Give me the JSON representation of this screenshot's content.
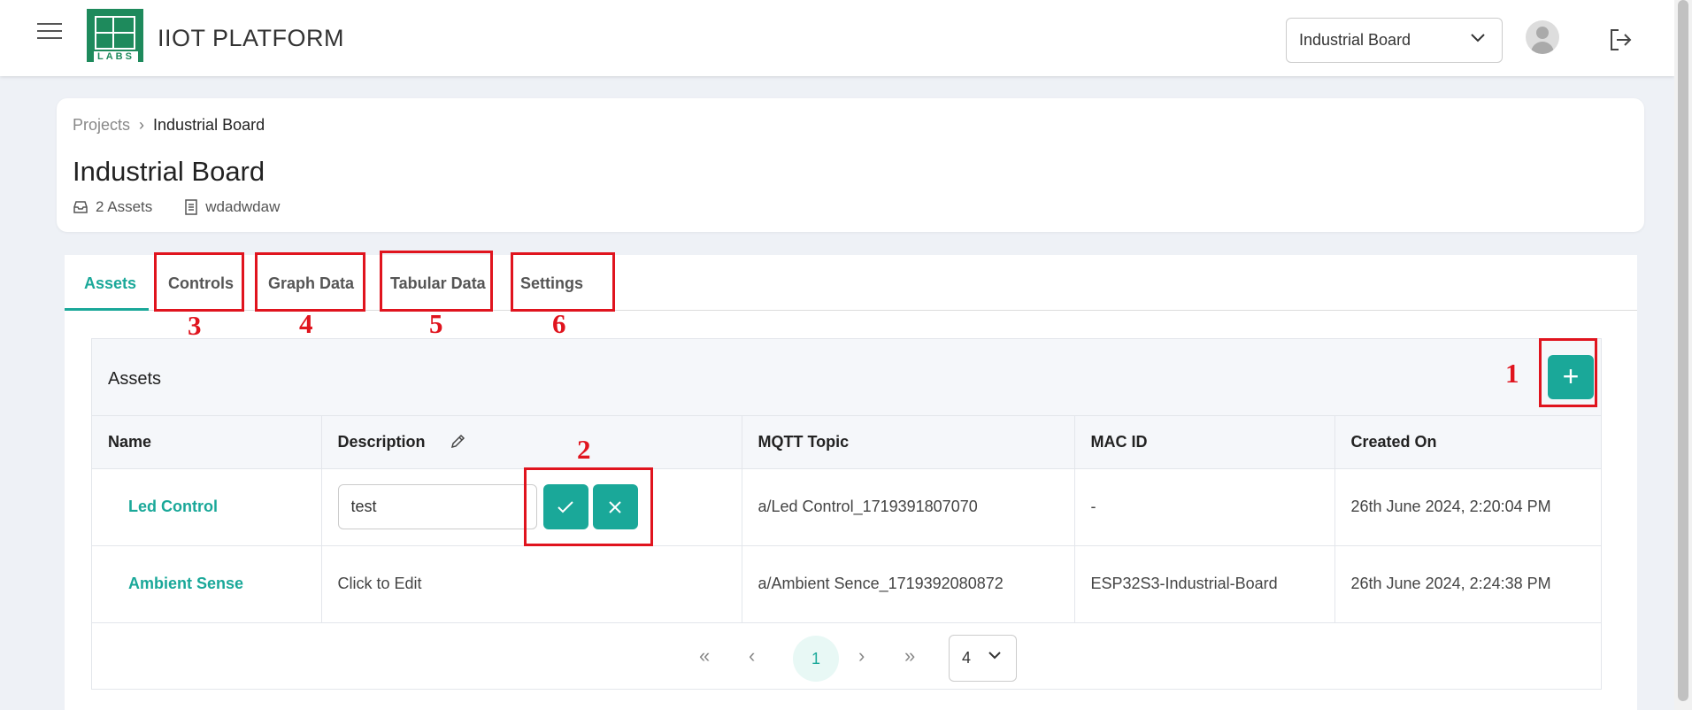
{
  "header": {
    "brand": "IIOT PLATFORM",
    "logo_text": "LABS",
    "project_select": "Industrial Board"
  },
  "breadcrumb": {
    "root": "Projects",
    "current": "Industrial Board"
  },
  "project": {
    "title": "Industrial Board",
    "assets_count": "2 Assets",
    "description": "wdadwdaw"
  },
  "tabs": [
    {
      "label": "Assets"
    },
    {
      "label": "Controls"
    },
    {
      "label": "Graph Data"
    },
    {
      "label": "Tabular Data"
    },
    {
      "label": "Settings"
    }
  ],
  "annotations": [
    "1",
    "2",
    "3",
    "4",
    "5",
    "6"
  ],
  "assets": {
    "title": "Assets",
    "add_label": "+",
    "columns": [
      "Name",
      "Description",
      "MQTT Topic",
      "MAC ID",
      "Created On"
    ],
    "rows": [
      {
        "name": "Led Control",
        "description": "test",
        "mqtt": "a/Led Control_1719391807070",
        "mac": "-",
        "created": "26th June 2024, 2:20:04 PM"
      },
      {
        "name": "Ambient Sense",
        "description": "Click to Edit",
        "mqtt": "a/Ambient Sence_1719392080872",
        "mac": "ESP32S3-Industrial-Board",
        "created": "26th June 2024, 2:24:38 PM"
      }
    ]
  },
  "pagination": {
    "first": "«",
    "prev": "‹",
    "current": "1",
    "next": "›",
    "last": "»",
    "page_size": "4"
  },
  "colors": {
    "accent": "#1aa899",
    "annotation": "#e0141e",
    "logo": "#1e8a5c"
  }
}
